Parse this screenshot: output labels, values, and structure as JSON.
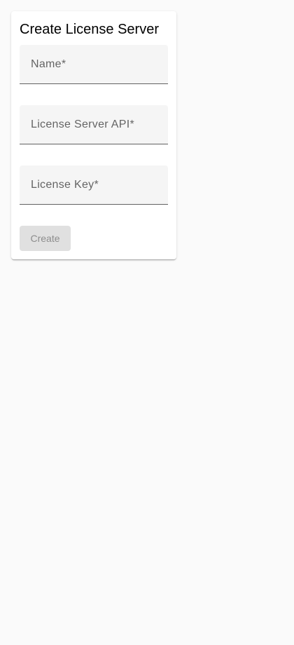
{
  "form": {
    "title": "Create License Server",
    "fields": [
      {
        "label": "Name*",
        "value": ""
      },
      {
        "label": "License Server API*",
        "value": ""
      },
      {
        "label": "License Key*",
        "value": ""
      }
    ],
    "submit_label": "Create",
    "submit_disabled": true
  },
  "colors": {
    "background": "#fafafa",
    "card": "#ffffff",
    "field_fill": "#f5f5f5",
    "button_disabled_bg": "#e0e0e0"
  }
}
